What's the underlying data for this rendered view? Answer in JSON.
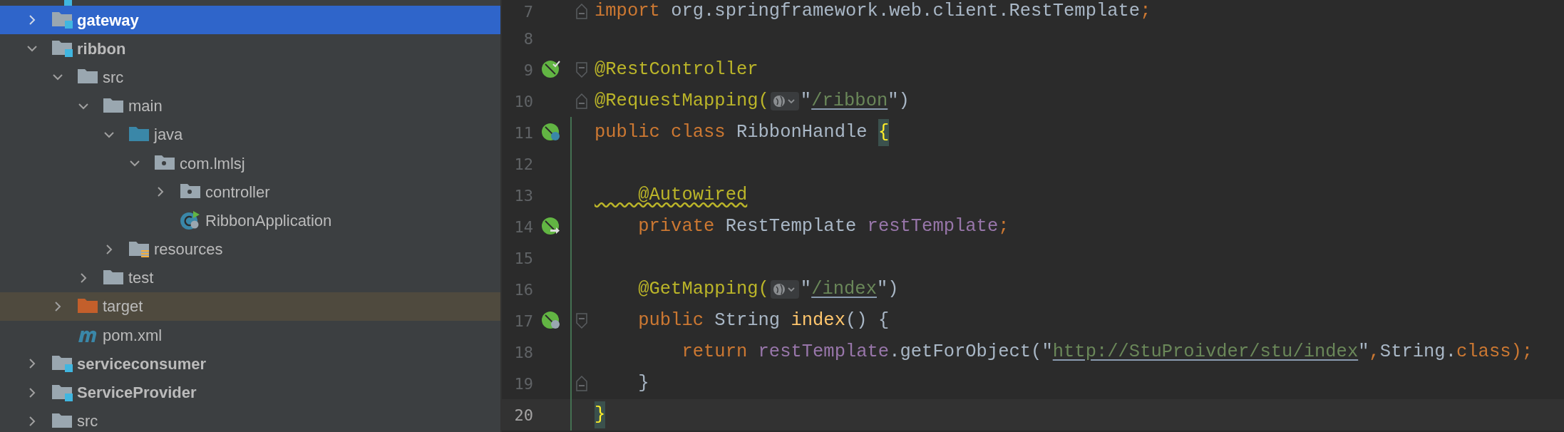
{
  "project_tree": [
    {
      "label": "gateway",
      "kind": "module",
      "expanded": false,
      "selected": true,
      "highlighted": false
    },
    {
      "label": "ribbon",
      "kind": "module",
      "expanded": true,
      "selected": false,
      "highlighted": false,
      "children": [
        {
          "label": "src",
          "kind": "folder",
          "expanded": true,
          "selected": false,
          "highlighted": false,
          "children": [
            {
              "label": "main",
              "kind": "folder",
              "expanded": true,
              "selected": false,
              "highlighted": false,
              "children": [
                {
                  "label": "java",
                  "kind": "source-folder",
                  "expanded": true,
                  "selected": false,
                  "highlighted": false,
                  "children": [
                    {
                      "label": "com.lmlsj",
                      "kind": "package",
                      "expanded": true,
                      "selected": false,
                      "highlighted": false,
                      "children": [
                        {
                          "label": "controller",
                          "kind": "package",
                          "expanded": false,
                          "selected": false,
                          "highlighted": false
                        },
                        {
                          "label": "RibbonApplication",
                          "kind": "spring-class",
                          "selected": false,
                          "highlighted": false
                        }
                      ]
                    }
                  ]
                },
                {
                  "label": "resources",
                  "kind": "resources-folder",
                  "expanded": false,
                  "selected": false,
                  "highlighted": false
                }
              ]
            },
            {
              "label": "test",
              "kind": "folder",
              "expanded": false,
              "selected": false,
              "highlighted": false
            }
          ]
        },
        {
          "label": "target",
          "kind": "excluded-folder",
          "expanded": false,
          "selected": false,
          "highlighted": true
        },
        {
          "label": "pom.xml",
          "kind": "maven",
          "selected": false,
          "highlighted": false
        }
      ]
    },
    {
      "label": "serviceconsumer",
      "kind": "module",
      "expanded": false,
      "selected": false,
      "highlighted": false
    },
    {
      "label": "ServiceProvider",
      "kind": "module",
      "expanded": false,
      "selected": false,
      "highlighted": false
    },
    {
      "label": "src",
      "kind": "folder",
      "expanded": false,
      "selected": false,
      "highlighted": false
    }
  ],
  "editor": {
    "lines": [
      {
        "number": "7",
        "fold": {
          "kind": "end"
        },
        "changed": false,
        "current": false,
        "tokens": [
          {
            "text": "import",
            "kind": "keyword"
          },
          {
            "text": " org.springframework.web.client.RestTemplate",
            "kind": "plain"
          },
          {
            "text": ";",
            "kind": "keyword"
          }
        ]
      },
      {
        "number": "8",
        "changed": false,
        "current": false
      },
      {
        "number": "9",
        "gutter_icon": {
          "kind": "bean-check"
        },
        "fold": {
          "kind": "start"
        },
        "changed": false,
        "current": false,
        "tokens": [
          {
            "text": "@RestController",
            "kind": "annotation"
          }
        ]
      },
      {
        "number": "10",
        "fold": {
          "kind": "end"
        },
        "changed": false,
        "current": false,
        "tokens": [
          {
            "text": "@RequestMapping(",
            "kind": "annotation"
          },
          {
            "kind": "url-hint"
          },
          {
            "text": "\"",
            "kind": "plain"
          },
          {
            "text": "/ribbon",
            "kind": "url"
          },
          {
            "text": "\")",
            "kind": "plain"
          }
        ]
      },
      {
        "number": "11",
        "gutter_icon": {
          "kind": "bean-class"
        },
        "changed": true,
        "current": false,
        "tokens": [
          {
            "text": "public class",
            "kind": "keyword"
          },
          {
            "text": " RibbonHandle ",
            "kind": "plain"
          },
          {
            "text": "{",
            "kind": "matched-brace"
          }
        ]
      },
      {
        "number": "12",
        "changed": true,
        "current": false
      },
      {
        "number": "13",
        "changed": true,
        "current": false,
        "tokens": [
          {
            "text": "    @Autowired",
            "kind": "annotation-warning"
          }
        ]
      },
      {
        "number": "14",
        "gutter_icon": {
          "kind": "autowired"
        },
        "changed": true,
        "current": false,
        "tokens": [
          {
            "text": "    private",
            "kind": "keyword"
          },
          {
            "text": " RestTemplate ",
            "kind": "plain"
          },
          {
            "text": "restTemplate",
            "kind": "field"
          },
          {
            "text": ";",
            "kind": "keyword"
          }
        ]
      },
      {
        "number": "15",
        "changed": true,
        "current": false
      },
      {
        "number": "16",
        "changed": true,
        "current": false,
        "tokens": [
          {
            "text": "    @GetMapping(",
            "kind": "annotation"
          },
          {
            "kind": "url-hint"
          },
          {
            "text": "\"",
            "kind": "plain"
          },
          {
            "text": "/index",
            "kind": "url"
          },
          {
            "text": "\")",
            "kind": "plain"
          }
        ]
      },
      {
        "number": "17",
        "gutter_icon": {
          "kind": "endpoint"
        },
        "fold": {
          "kind": "start"
        },
        "changed": true,
        "current": false,
        "tokens": [
          {
            "text": "    public",
            "kind": "keyword"
          },
          {
            "text": " String ",
            "kind": "plain"
          },
          {
            "text": "index",
            "kind": "method"
          },
          {
            "text": "() {",
            "kind": "plain"
          }
        ]
      },
      {
        "number": "18",
        "changed": true,
        "current": false,
        "tokens": [
          {
            "text": "        return ",
            "kind": "keyword"
          },
          {
            "text": "restTemplate",
            "kind": "field"
          },
          {
            "text": ".getForObject(\"",
            "kind": "plain"
          },
          {
            "text": "http://StuProivder/stu/index",
            "kind": "url"
          },
          {
            "text": "\"",
            "kind": "plain"
          },
          {
            "text": ",",
            "kind": "keyword"
          },
          {
            "text": "String.",
            "kind": "plain"
          },
          {
            "text": "class",
            "kind": "keyword"
          },
          {
            "text": ");",
            "kind": "keyword"
          }
        ]
      },
      {
        "number": "19",
        "fold": {
          "kind": "end"
        },
        "changed": true,
        "current": false,
        "tokens": [
          {
            "text": "    }",
            "kind": "plain"
          }
        ]
      },
      {
        "number": "20",
        "changed": true,
        "current": true,
        "tokens": [
          {
            "text": "}",
            "kind": "matched-brace"
          }
        ]
      }
    ]
  }
}
